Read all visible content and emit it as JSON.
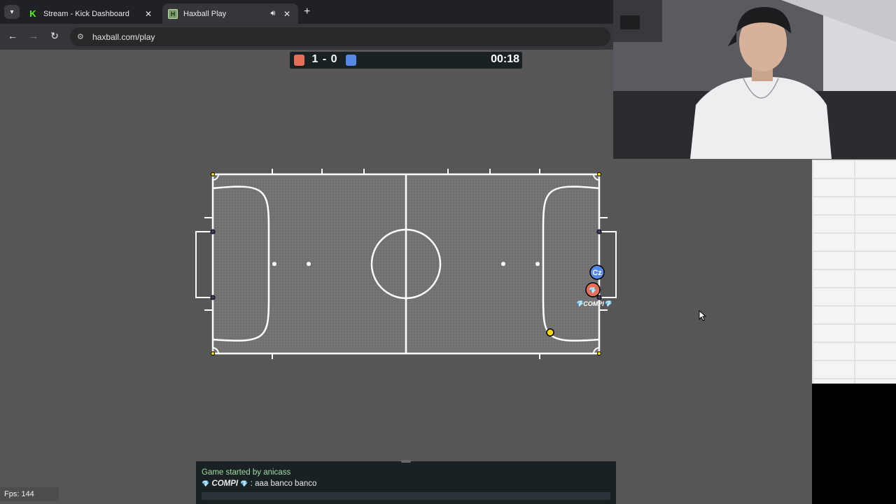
{
  "browser": {
    "tabs": [
      {
        "title": "Stream - Kick Dashboard",
        "favicon": "kick-logo",
        "active": false
      },
      {
        "title": "Haxball Play",
        "favicon": "haxball-logo",
        "active": true
      }
    ],
    "url": "haxball.com/play"
  },
  "scoreboard": {
    "score": "1 - 0",
    "time": "00:18",
    "red_color": "#e56e56",
    "blue_color": "#5689e5"
  },
  "players": [
    {
      "team": "blue",
      "avatar": "Cz",
      "color": "#5689e5"
    },
    {
      "team": "red",
      "avatar": "💎",
      "name": "COMPI",
      "color": "#e56e56"
    }
  ],
  "field": {
    "ball_color": "#ffd700"
  },
  "chat": {
    "messages": [
      {
        "type": "system",
        "text": "Game started by anicass"
      },
      {
        "type": "player",
        "author": "COMPI",
        "text": ": aaa banco banco"
      }
    ],
    "input_value": ""
  },
  "fps": "Fps: 144"
}
